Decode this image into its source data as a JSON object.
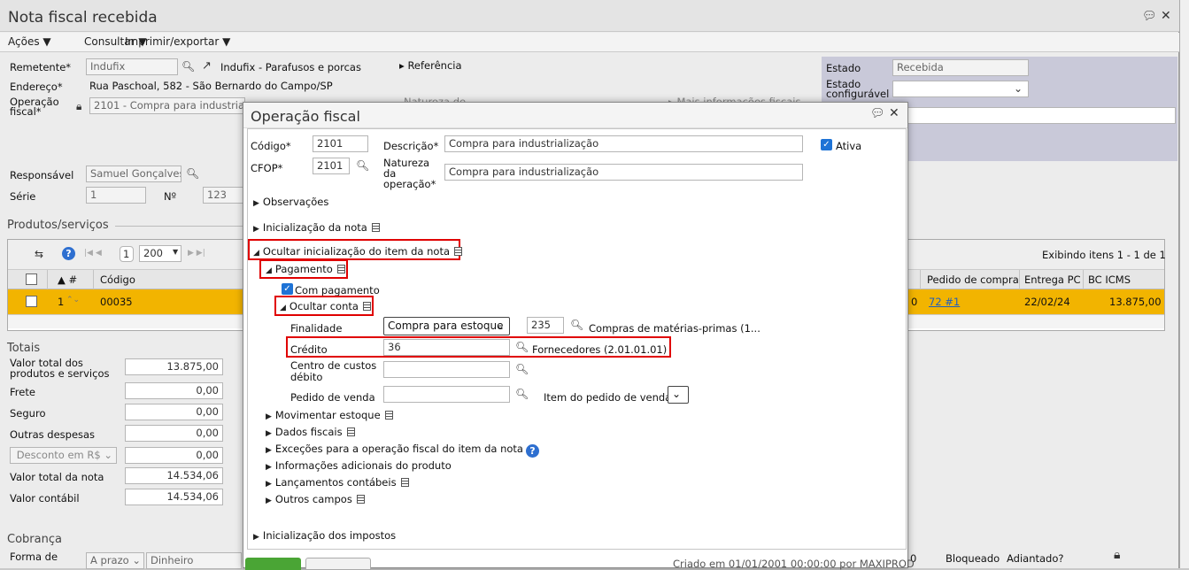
{
  "window": {
    "title": "Nota fiscal recebida"
  },
  "menu": [
    "Ações ▼",
    "Consultar ▼",
    "Imprimir/exportar ▼"
  ],
  "header": {
    "remetente_label": "Remetente*",
    "remetente_value": "Indufix",
    "remetente_name": "Indufix - Parafusos e porcas",
    "referencia": "Referência",
    "endereco_label": "Endereço*",
    "endereco_value": "Rua Paschoal, 582 - São Bernardo do Campo/SP",
    "operacao_label": "Operação fiscal*",
    "operacao_value": "2101 - Compra para industrial",
    "natureza_label": "Natureza de",
    "mais_info": "Mais informações fiscais",
    "responsavel_label": "Responsável",
    "responsavel_value": "Samuel Gonçalves",
    "serie_label": "Série",
    "serie_value": "1",
    "numero_label": "Nº",
    "numero_value": "123"
  },
  "status_panel": {
    "estado_label": "Estado",
    "estado_value": "Recebida",
    "estado_config_label": "Estado configurável"
  },
  "products": {
    "section": "Produtos/serviços",
    "page": "1",
    "per_page": "200",
    "exibindo": "Exibindo itens 1 - 1 de 1",
    "col_num": "▲ #",
    "col_codigo": "Código",
    "col_pedido": "Pedido de compra",
    "col_entrega": "Entrega PC",
    "col_bc": "BC ICMS",
    "row": {
      "num": "1",
      "codigo": "00035",
      "pedido": "72 #1",
      "entrega": "22/02/24",
      "bc": "13.875,00",
      "col_zero": "0"
    }
  },
  "totals": {
    "section": "Totais",
    "rows": [
      {
        "label": "Valor total dos produtos e serviços",
        "value": "13.875,00"
      },
      {
        "label": "Frete",
        "value": "0,00"
      },
      {
        "label": "Seguro",
        "value": "0,00"
      },
      {
        "label": "Outras despesas",
        "value": "0,00"
      },
      {
        "label": "Desconto em R$",
        "value": "0,00"
      },
      {
        "label": "Valor total da nota",
        "value": "14.534,06"
      },
      {
        "label": "Valor contábil",
        "value": "14.534,06"
      }
    ]
  },
  "cobranca": {
    "section": "Cobrança",
    "forma_label": "Forma de",
    "forma_value": "A prazo",
    "dinheiro": "Dinheiro",
    "col_zero": "0",
    "bloqueado": "Bloqueado",
    "adiantado": "Adiantado?"
  },
  "modal": {
    "title": "Operação fiscal",
    "codigo_label": "Código*",
    "codigo_value": "2101",
    "descricao_label": "Descrição*",
    "descricao_value": "Compra para industrialização",
    "ativa": "Ativa",
    "cfop_label": "CFOP*",
    "cfop_value": "2101",
    "natureza_label": "Natureza da operação*",
    "natureza_value": "Compra para industrialização",
    "observacoes": "Observações",
    "inicializacao_nota": "Inicialização da nota",
    "ocultar_inicializacao": "Ocultar inicialização do item da nota",
    "pagamento": "Pagamento",
    "com_pagamento": "Com pagamento",
    "ocultar_conta": "Ocultar conta",
    "finalidade_label": "Finalidade",
    "finalidade_value": "Compra para estoque",
    "finalidade_code": "235",
    "finalidade_desc": "Compras de matérias-primas (1...",
    "credito_label": "Crédito",
    "credito_value": "36",
    "credito_desc": "Fornecedores (2.01.01.01)",
    "centro_label": "Centro de custos débito",
    "pedido_venda_label": "Pedido de venda",
    "item_pedido_label": "Item do pedido de venda",
    "movimentar": "Movimentar estoque",
    "dados_fiscais": "Dados fiscais",
    "excecoes": "Exceções para a operação fiscal do item da nota",
    "info_adicionais": "Informações adicionais do produto",
    "lancamentos": "Lançamentos contábeis",
    "outros": "Outros campos",
    "inicializacao_impostos": "Inicialização dos impostos",
    "criado": "Criado em 01/01/2001 00:00:00 por MAXIPROD"
  }
}
